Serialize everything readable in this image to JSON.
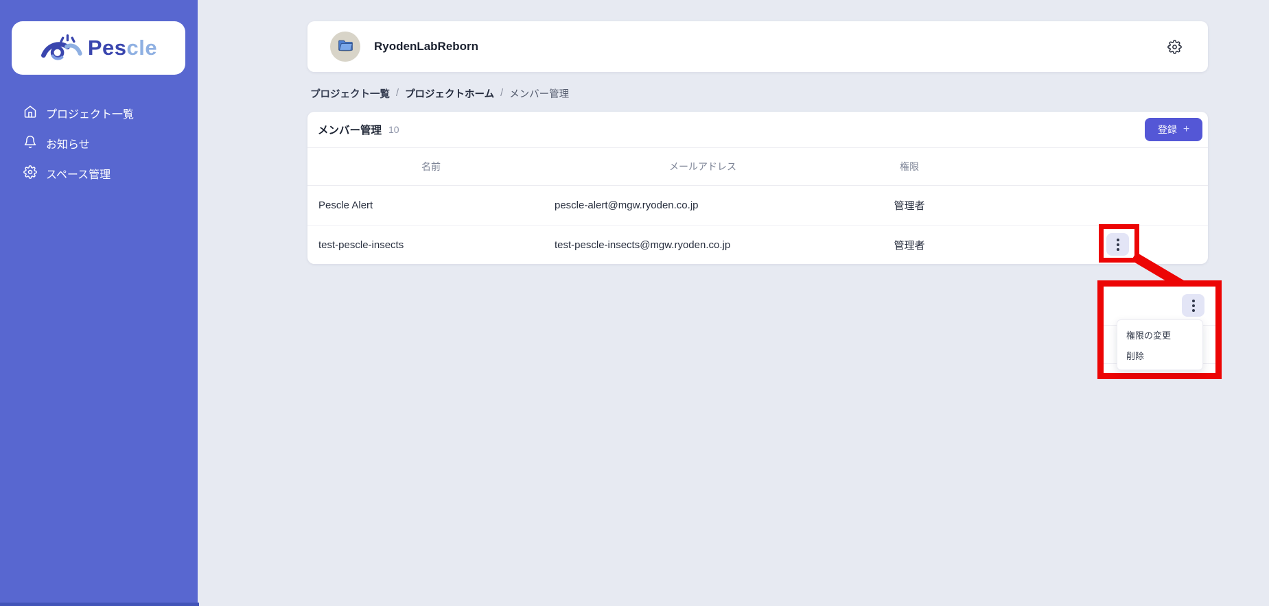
{
  "sidebar": {
    "brand": {
      "primary": "Pes",
      "secondary": "cle"
    },
    "items": [
      {
        "label": "プロジェクト一覧",
        "icon": "home-icon"
      },
      {
        "label": "お知らせ",
        "icon": "bell-icon"
      },
      {
        "label": "スペース管理",
        "icon": "gear-icon"
      }
    ]
  },
  "header": {
    "project_name": "RyodenLabReborn"
  },
  "breadcrumb": {
    "items": [
      "プロジェクト一覧",
      "プロジェクトホーム",
      "メンバー管理"
    ],
    "separator": "/"
  },
  "members": {
    "title": "メンバー管理",
    "count": "10",
    "register_label": "登録",
    "register_plus": "+",
    "columns": [
      "名前",
      "メールアドレス",
      "権限"
    ],
    "rows": [
      {
        "name": "Pescle Alert",
        "email": "pescle-alert@mgw.ryoden.co.jp",
        "role": "管理者"
      },
      {
        "name": "test-pescle-insects",
        "email": "test-pescle-insects@mgw.ryoden.co.jp",
        "role": "管理者"
      }
    ]
  },
  "context_menu": {
    "items": [
      "権限の変更",
      "削除"
    ]
  },
  "colors": {
    "sidebar": "#5867d0",
    "accent_button": "#5457d6",
    "annotation_red": "#ec0505",
    "page_background": "#e7eaf2",
    "kebab_background": "#e3e5f6"
  }
}
